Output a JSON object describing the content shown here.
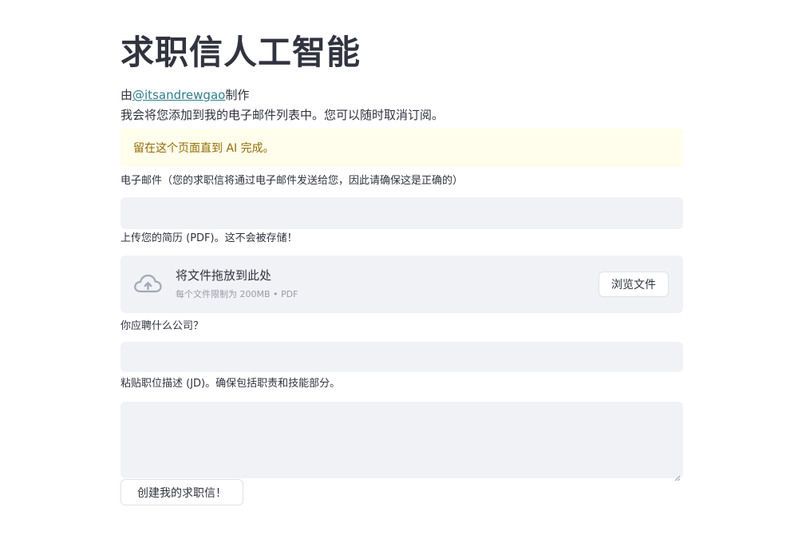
{
  "page": {
    "title": "求职信人工智能",
    "byline_prefix": "由",
    "byline_link": "@itsandrewgao",
    "byline_suffix": "制作",
    "intro": "我会将您添加到我的电子邮件列表中。您可以随时取消订阅。",
    "alert": "留在这个页面直到 AI 完成。"
  },
  "form": {
    "email": {
      "label": "电子邮件（您的求职信将通过电子邮件发送给您，因此请确保这是正确的）",
      "value": ""
    },
    "resume": {
      "label": "上传您的简历 (PDF)。这不会被存储！",
      "drop_title": "将文件拖放到此处",
      "drop_sub": "每个文件限制为 200MB • PDF",
      "browse_label": "浏览文件",
      "icon": "cloud-upload-icon"
    },
    "company": {
      "label": "你应聘什么公司？",
      "value": ""
    },
    "jd": {
      "label": "粘贴职位描述 (JD)。确保包括职责和技能部分。",
      "value": ""
    },
    "submit_label": "创建我的求职信！"
  },
  "colors": {
    "text": "#31333f",
    "link": "#2e7d8c",
    "alert_bg": "#fffdeb",
    "alert_text": "#926c05",
    "input_bg": "#f0f2f6",
    "muted": "#9a9ca6"
  }
}
